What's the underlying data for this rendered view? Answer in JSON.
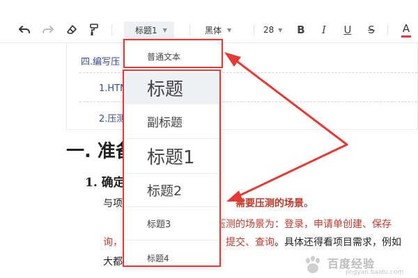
{
  "toolbar": {
    "style_select": "标题1",
    "font_select": "黑体",
    "size_select": "28",
    "bold": "B",
    "italic": "I",
    "underline": "U",
    "strike": "S",
    "font_color": "A",
    "accent_color": "#e53935"
  },
  "toc": {
    "line1": "四.编写压",
    "line2": "1.HTM",
    "line3": "2.压测"
  },
  "doc": {
    "heading_main": "一. 准备",
    "heading_sub": "1. 确定",
    "p1_pre": "与项",
    "p1_red": "需要压测的场景",
    "p1_post": "。",
    "p2_red1": "压测的场景为：",
    "p2_red2": "登录，申请单创建、保存",
    "p3_red1": "询，",
    "p3_red2": "提交、查询",
    "p3_post": "。具体还得看项目需求，例如",
    "p4": "大都"
  },
  "dropdown": {
    "items": [
      {
        "label": "普通文本"
      },
      {
        "label": "标题"
      },
      {
        "label": "副标题"
      },
      {
        "label": "标题1"
      },
      {
        "label": "标题2"
      },
      {
        "label": "标题3"
      },
      {
        "label": "标题4"
      }
    ]
  },
  "watermark": {
    "text": "百度经验",
    "url": "jingyan.baidu.com"
  }
}
